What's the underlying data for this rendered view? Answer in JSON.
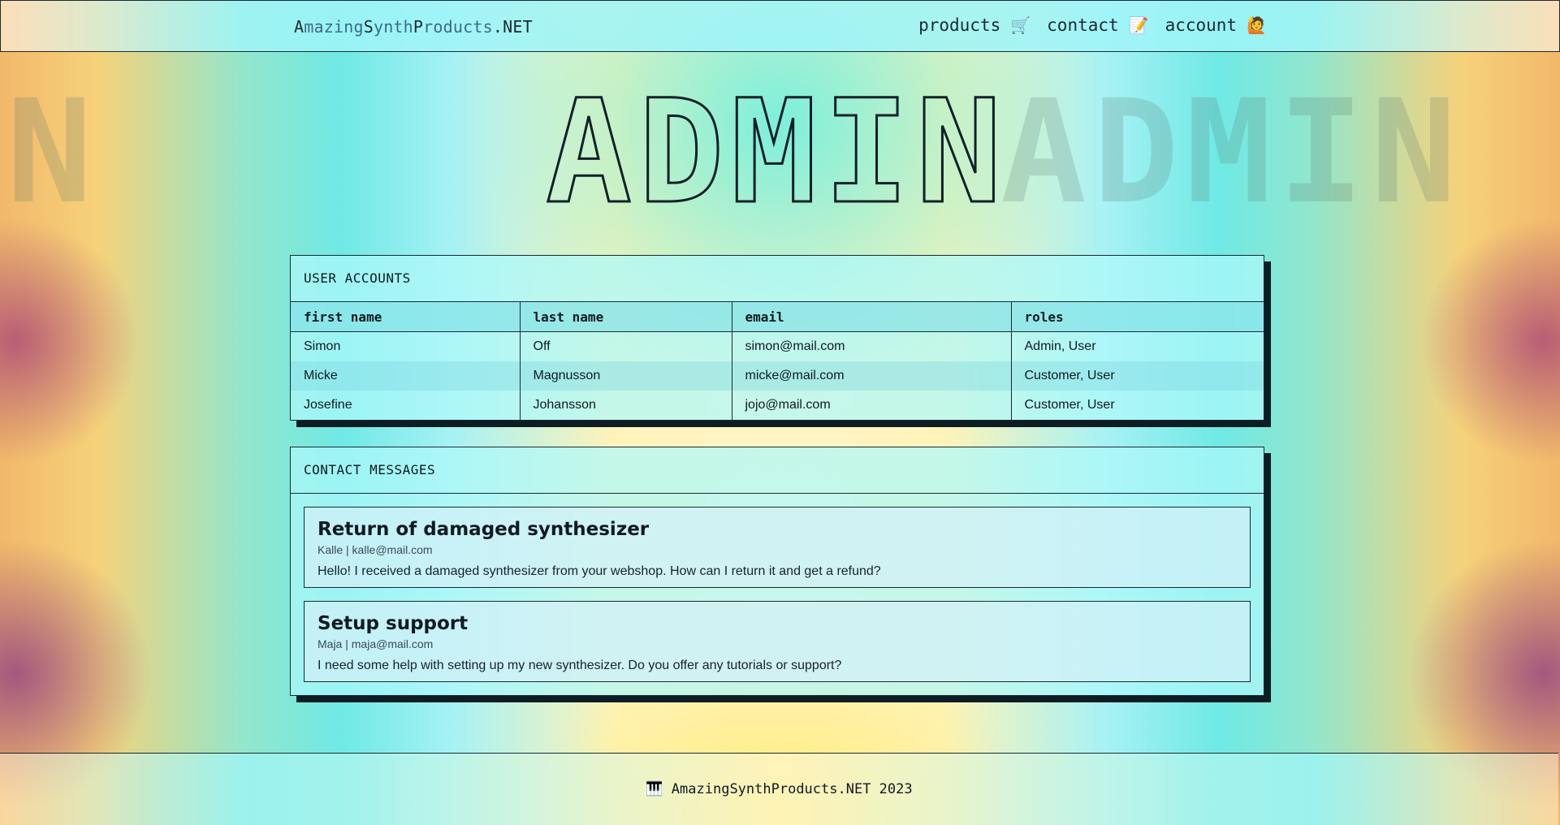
{
  "header": {
    "brand_parts": [
      "A",
      "mazing",
      "S",
      "ynth",
      "P",
      "roducts",
      ".NET"
    ],
    "nav": [
      {
        "label": "products",
        "icon": "shopping-cart-icon",
        "glyph": "🛒"
      },
      {
        "label": "contact",
        "icon": "memo-icon",
        "glyph": "📝"
      },
      {
        "label": "account",
        "icon": "person-raising-hand-icon",
        "glyph": "🙋"
      }
    ]
  },
  "hero": {
    "word": "ADMIN"
  },
  "user_accounts": {
    "title": "USER ACCOUNTS",
    "columns": [
      "first name",
      "last name",
      "email",
      "roles"
    ],
    "rows": [
      [
        "Simon",
        "Off",
        "simon@mail.com",
        "Admin, User"
      ],
      [
        "Micke",
        "Magnusson",
        "micke@mail.com",
        "Customer, User"
      ],
      [
        "Josefine",
        "Johansson",
        "jojo@mail.com",
        "Customer, User"
      ]
    ]
  },
  "contact_messages": {
    "title": "CONTACT MESSAGES",
    "messages": [
      {
        "subject": "Return of damaged synthesizer",
        "meta": "Kalle | kalle@mail.com",
        "body": "Hello! I received a damaged synthesizer from your webshop. How can I return it and get a refund?"
      },
      {
        "subject": "Setup support",
        "meta": "Maja | maja@mail.com",
        "body": "I need some help with setting up my new synthesizer. Do you offer any tutorials or support?"
      }
    ]
  },
  "footer": {
    "icon": "piano-keys-icon",
    "glyph": "🎹",
    "text": "AmazingSynthProducts.NET 2023"
  }
}
